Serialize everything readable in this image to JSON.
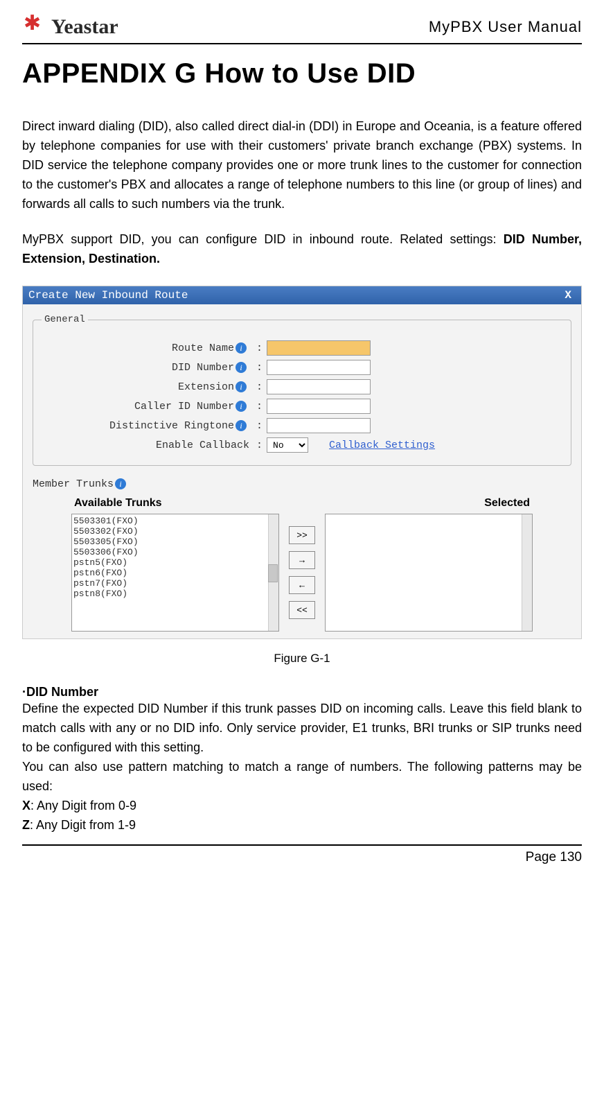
{
  "header": {
    "brand": "Yeastar",
    "doc_title": "MyPBX User Manual"
  },
  "title": "APPENDIX G How to Use DID",
  "intro": "Direct inward dialing (DID), also called direct dial-in (DDI) in Europe and Oceania, is a feature offered by telephone companies for use with their customers' private branch exchange (PBX) systems. In DID service the telephone company provides one or more trunk lines to the customer for connection to the customer's PBX and allocates a range of telephone numbers to this line (or group of lines) and forwards all calls to such numbers via the trunk.",
  "support_line_prefix": "MyPBX support DID, you can configure DID in inbound route. Related settings: ",
  "support_line_bold": "DID Number, Extension, Destination.",
  "dialog": {
    "title": "Create New Inbound Route",
    "close": "X",
    "legend_general": "General",
    "labels": {
      "route_name": "Route Name",
      "did_number": "DID Number",
      "extension": "Extension",
      "caller_id": "Caller ID Number",
      "ringtone": "Distinctive Ringtone",
      "enable_cb": "Enable Callback",
      "member_trunks": "Member Trunks",
      "available": "Available Trunks",
      "selected": "Selected"
    },
    "enable_cb_value": "No",
    "callback_link": "Callback Settings",
    "available_items": [
      "5503301(FXO)",
      "5503302(FXO)",
      "5503305(FXO)",
      "5503306(FXO)",
      "pstn5(FXO)",
      "pstn6(FXO)",
      "pstn7(FXO)",
      "pstn8(FXO)"
    ],
    "move_buttons": {
      "all_right": ">>",
      "right": "→",
      "left": "←",
      "all_left": "<<"
    }
  },
  "figure_caption": "Figure G-1",
  "did_header": "·DID Number",
  "did_para1": "Define the expected DID Number if this trunk passes DID on incoming calls. Leave this field blank to match calls with any or no DID info. Only service provider, E1 trunks, BRI trunks or SIP trunks need to be configured with this setting.",
  "did_para2": "You can also use pattern matching to match a range of numbers. The following patterns may be used:",
  "patterns": {
    "x_key": "X",
    "x_desc": ": Any Digit from 0-9",
    "z_key": "Z",
    "z_desc": ": Any Digit from 1-9"
  },
  "page_number": "Page 130"
}
